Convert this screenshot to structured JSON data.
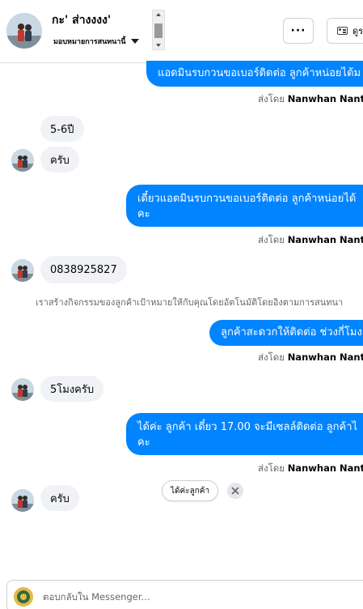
{
  "header": {
    "contact_name": "กะ' ส่างงงง'",
    "assign_label": "มอบหมายการสนทนานี้",
    "more_label": "···",
    "contact_button_label": "ดูร"
  },
  "messages": {
    "out_1": "แอดมินรบกวนขอเบอร์ติดต่อ ลูกค้าหน่อยได้ม",
    "sent_by_1_prefix": "ส่งโดย",
    "sent_by_1_name": "Nanwhan Nanth",
    "in_1": "5-6ปี",
    "in_2": "ครับ",
    "out_2_line1": "เดี๋ยวแอดมินรบกวนขอเบอร์ติดต่อ ลูกค้าหน่อยได้",
    "out_2_line2": "คะ",
    "sent_by_2_prefix": "ส่งโดย",
    "sent_by_2_name": "Nanwhan Nanth",
    "in_3": "0838925827",
    "system_note": "เราสร้างกิจกรรมของลูกค้าเป้าหมายให้กับคุณโดยอัตโนมัติโดยอิงตามการสนทนา",
    "out_3": "ลูกค้าสะดวกให้ติดต่อ ช่วงกี่โมง",
    "sent_by_3_prefix": "ส่งโดย",
    "sent_by_3_name": "Nanwhan Nanth",
    "in_4": "5โมงครับ",
    "out_4_line1": "ได้ค่ะ ลูกค้า เดี๋ยว 17.00 จะมีเซลล์ติดต่อ ลูกค้าไ",
    "out_4_line2": "คะ",
    "sent_by_4_prefix": "ส่งโดย",
    "sent_by_4_name": "Nanwhan Nanth",
    "in_5": "ครับ"
  },
  "quick_reply": {
    "label": "ได้ค่ะลูกค้า"
  },
  "composer": {
    "placeholder": "ตอบกลับใน Messenger..."
  },
  "colors": {
    "accent": "#0084ff",
    "incoming_bubble": "#f0f2f5",
    "muted_text": "#65676b"
  }
}
